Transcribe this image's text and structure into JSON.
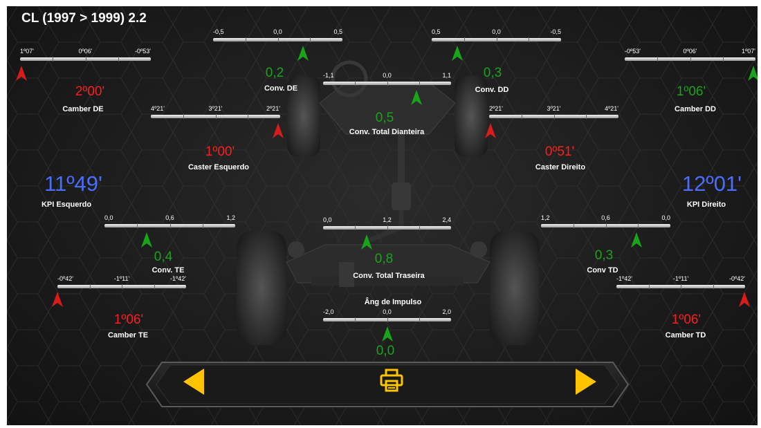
{
  "title": "CL (1997 > 1999) 2.2",
  "colors": {
    "red": "#ff1e1e",
    "green": "#19a419",
    "blue": "#4a6cff",
    "nav_yellow": "#ffc400"
  },
  "gauges": {
    "conv_de": {
      "labels": [
        "-0,5",
        "0,0",
        "0,5"
      ]
    },
    "conv_dd": {
      "labels": [
        "0,5",
        "0,0",
        "-0,5"
      ]
    },
    "camber_de": {
      "labels": [
        "1º07'",
        "0º06'",
        "-0º53'"
      ]
    },
    "camber_dd": {
      "labels": [
        "-0º53'",
        "0º06'",
        "1º07'"
      ]
    },
    "conv_total_dianteira": {
      "labels": [
        "-1,1",
        "0,0",
        "1,1"
      ]
    },
    "caster_esquerdo": {
      "labels": [
        "4º21'",
        "3º21'",
        "2º21'"
      ]
    },
    "caster_direito": {
      "labels": [
        "2º21'",
        "3º21'",
        "4º21'"
      ]
    },
    "conv_te": {
      "labels": [
        "0,0",
        "0,6",
        "1,2"
      ]
    },
    "conv_total_traseira": {
      "labels": [
        "0,0",
        "1,2",
        "2,4"
      ]
    },
    "conv_td": {
      "labels": [
        "1,2",
        "0,6",
        "0,0"
      ]
    },
    "camber_te": {
      "labels": [
        "-0º42'",
        "-1º11'",
        "-1º42'"
      ]
    },
    "camber_td": {
      "labels": [
        "-1º42'",
        "-1º11'",
        "-0º42'"
      ]
    },
    "ang_impulso": {
      "labels": [
        "-2,0",
        "0,0",
        "2,0"
      ]
    }
  },
  "readings": {
    "camber_de": {
      "value": "2º00'",
      "label": "Camber DE",
      "status": "red"
    },
    "conv_de": {
      "value": "0,2",
      "label": "Conv. DE",
      "status": "green"
    },
    "conv_dd": {
      "value": "0,3",
      "label": "Conv. DD",
      "status": "green"
    },
    "camber_dd": {
      "value": "1º06'",
      "label": "Camber DD",
      "status": "green"
    },
    "conv_total_dianteira": {
      "value": "0,5",
      "label": "Conv. Total Dianteira",
      "status": "green"
    },
    "caster_esquerdo": {
      "value": "1º00'",
      "label": "Caster Esquerdo",
      "status": "red"
    },
    "caster_direito": {
      "value": "0º51'",
      "label": "Caster Direito",
      "status": "red"
    },
    "kpi_esquerdo": {
      "value": "11º49'",
      "label": "KPI Esquerdo",
      "status": "blue"
    },
    "kpi_direito": {
      "value": "12º01'",
      "label": "KPI Direito",
      "status": "blue"
    },
    "conv_te": {
      "value": "0,4",
      "label": "Conv. TE",
      "status": "green"
    },
    "conv_total_traseira": {
      "value": "0,8",
      "label": "Conv. Total Traseira",
      "status": "green"
    },
    "conv_td": {
      "value": "0,3",
      "label": "Conv TD",
      "status": "green"
    },
    "camber_te": {
      "value": "1º06'",
      "label": "Camber TE",
      "status": "red"
    },
    "camber_td": {
      "value": "1º06'",
      "label": "Camber TD",
      "status": "red"
    },
    "ang_impulso": {
      "value": "0,0",
      "label": "Âng de Impulso",
      "status": "green"
    }
  },
  "nav": {
    "prev_icon": "triangle-left-icon",
    "print_icon": "printer-icon",
    "next_icon": "triangle-right-icon"
  }
}
